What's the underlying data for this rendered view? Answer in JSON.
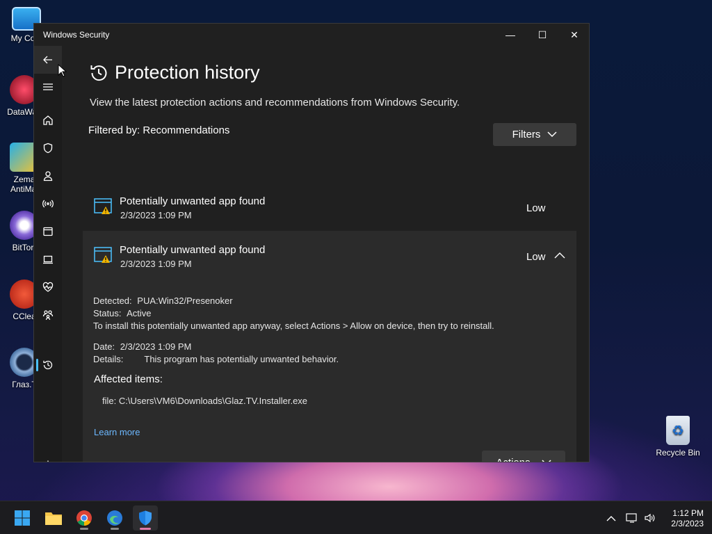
{
  "desktop": {
    "icons": [
      {
        "label": "My Com"
      },
      {
        "label": "DataWag"
      },
      {
        "label": "Zema AntiMal"
      },
      {
        "label": "BitTorr"
      },
      {
        "label": "CClea"
      },
      {
        "label": "Глаз.Т"
      },
      {
        "label": "Recycle Bin"
      }
    ]
  },
  "window": {
    "title": "Windows Security",
    "controls": {
      "minimize": "—",
      "maximize": "☐",
      "close": "✕"
    }
  },
  "nav": {
    "items": [
      {
        "icon": "back-arrow-icon"
      },
      {
        "icon": "hamburger-menu-icon"
      },
      {
        "icon": "home-icon"
      },
      {
        "icon": "shield-icon"
      },
      {
        "icon": "person-icon"
      },
      {
        "icon": "wifi-antenna-icon"
      },
      {
        "icon": "app-browser-icon"
      },
      {
        "icon": "laptop-icon"
      },
      {
        "icon": "heart-pulse-icon"
      },
      {
        "icon": "family-icon"
      },
      {
        "icon": "history-icon"
      },
      {
        "icon": "gear-icon"
      }
    ],
    "selected": "history-icon"
  },
  "page": {
    "title": "Protection history",
    "subtitle": "View the latest protection actions and recommendations from Windows Security.",
    "filtered_by": "Filtered by: Recommendations",
    "filters_label": "Filters"
  },
  "items": [
    {
      "title": "Potentially unwanted app found",
      "date": "2/3/2023 1:09 PM",
      "severity": "Low",
      "expanded": false
    },
    {
      "title": "Potentially unwanted app found",
      "date": "2/3/2023 1:09 PM",
      "severity": "Low",
      "expanded": true,
      "detected_label": "Detected:",
      "detected_value": "PUA:Win32/Presenoker",
      "status_label": "Status:",
      "status_value": "Active",
      "instruction": "To install this potentially unwanted app anyway, select Actions > Allow on device, then try to reinstall.",
      "date_label": "Date:",
      "date_value": "2/3/2023 1:09 PM",
      "details_label": "Details:",
      "details_value": "This program has potentially unwanted behavior.",
      "affected_heading": "Affected items:",
      "affected_file": "file: C:\\Users\\VM6\\Downloads\\Glaz.TV.Installer.exe",
      "learn_more": "Learn more",
      "actions_label": "Actions"
    }
  ],
  "taskbar": {
    "apps": [
      "start-icon",
      "file-explorer-icon",
      "chrome-icon",
      "edge-icon",
      "windows-security-icon"
    ],
    "active": "windows-security-icon",
    "time": "1:12 PM",
    "date": "2/3/2023"
  },
  "colors": {
    "accent": "#4cc2ff",
    "link": "#6cb8ff",
    "warning": "#f0b400",
    "window_bg": "#202020",
    "expanded_bg": "#2b2b2b"
  }
}
